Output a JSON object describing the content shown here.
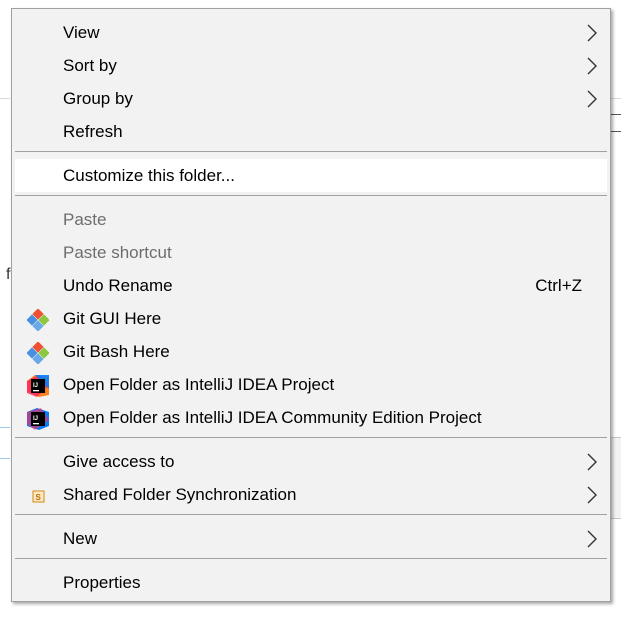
{
  "menu": {
    "items": {
      "view": "View",
      "sort_by": "Sort by",
      "group_by": "Group by",
      "refresh": "Refresh",
      "customize": "Customize this folder...",
      "paste": "Paste",
      "paste_shortcut": "Paste shortcut",
      "undo_rename": "Undo Rename",
      "undo_shortcut": "Ctrl+Z",
      "git_gui": "Git GUI Here",
      "git_bash": "Git Bash Here",
      "intellij": "Open Folder as IntelliJ IDEA Project",
      "intellij_ce": "Open Folder as IntelliJ IDEA Community Edition Project",
      "give_access": "Give access to",
      "shared_sync": "Shared Folder Synchronization",
      "new": "New",
      "properties": "Properties"
    }
  },
  "background": {
    "left_fragment": "f"
  },
  "colors": {
    "menu_bg": "#f2f2f2",
    "hover_bg": "#ffffff",
    "separator": "#a0a0a0",
    "disabled_text": "#6d6d6d"
  }
}
